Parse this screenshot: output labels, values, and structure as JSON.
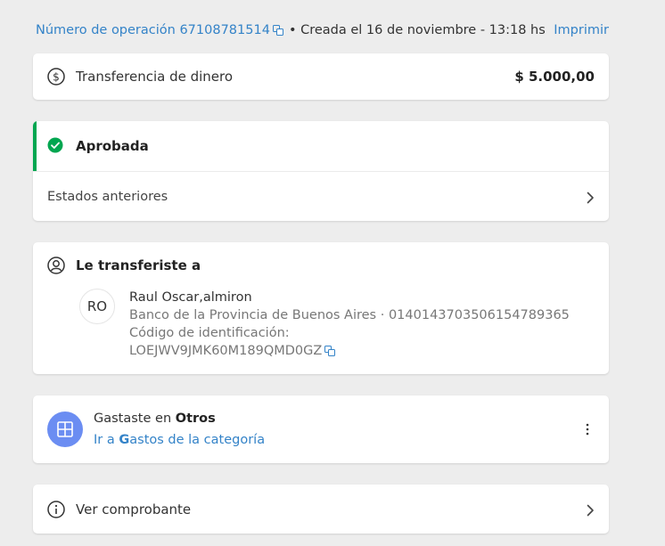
{
  "header": {
    "operation_label": "Número de operación 67108781514",
    "created_label": "• Creada el 16 de noviembre - 13:18 hs",
    "print_label": "Imprimir"
  },
  "summary": {
    "title": "Transferencia de dinero",
    "amount": "$ 5.000,00"
  },
  "status": {
    "current": "Aprobada",
    "previous_label": "Estados anteriores",
    "color": "#00a650"
  },
  "recipient": {
    "heading": "Le transferiste a",
    "initials": "RO",
    "name": "Raul Oscar,almiron",
    "bank_line": "Banco de la Provincia de Buenos Aires · 0140143703506154789365",
    "id_label": "Código de identificación:",
    "id_code": "LOEJWV9JMK60M189QMD0GZ"
  },
  "category": {
    "spent_prefix": "Gastaste en ",
    "spent_category": "Otros",
    "link_prefix": "Ir a ",
    "link_bold": "G",
    "link_rest": "astos de la categoría"
  },
  "receipt": {
    "label": "Ver comprobante"
  },
  "colors": {
    "link": "#3483c8",
    "category_icon": "#6b8df2"
  }
}
